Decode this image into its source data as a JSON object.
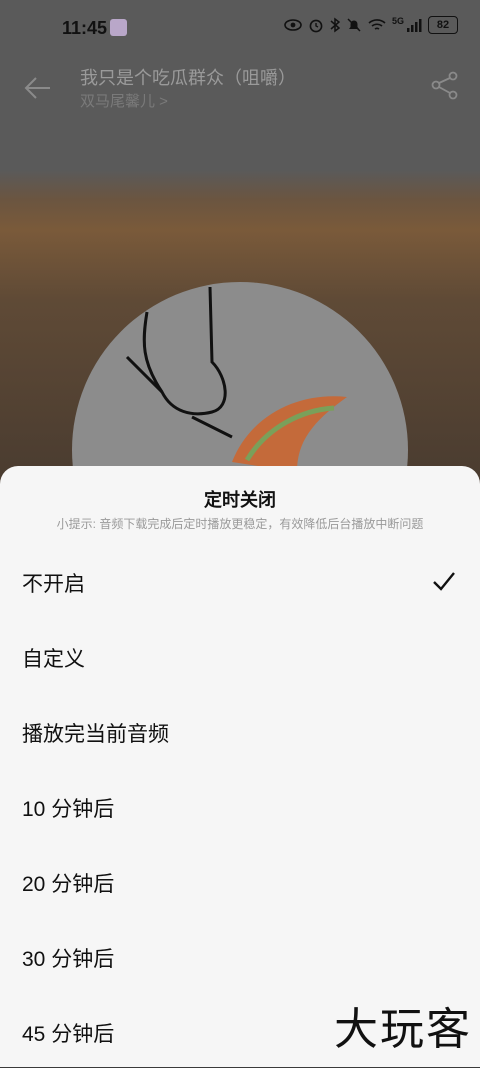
{
  "status_bar": {
    "time": "11:45",
    "battery": "82",
    "network": "5G"
  },
  "player": {
    "title": "我只是个吃瓜群众（咀嚼）",
    "artist": "双马尾馨儿 >"
  },
  "sheet": {
    "title": "定时关闭",
    "tip": "小提示: 音频下载完成后定时播放更稳定，有效降低后台播放中断问题",
    "options": [
      {
        "label": "不开启",
        "selected": true
      },
      {
        "label": "自定义",
        "selected": false
      },
      {
        "label": "播放完当前音频",
        "selected": false
      },
      {
        "label": "10 分钟后",
        "selected": false
      },
      {
        "label": "20 分钟后",
        "selected": false
      },
      {
        "label": "30 分钟后",
        "selected": false
      },
      {
        "label": "45 分钟后",
        "selected": false
      }
    ]
  },
  "watermark": "大玩客",
  "icons": {
    "back": "arrow-left-icon",
    "share": "share-icon",
    "check": "checkmark-icon"
  },
  "colors": {
    "sheet_bg": "#f6f6f6",
    "overlay": "#5a5a5a"
  }
}
